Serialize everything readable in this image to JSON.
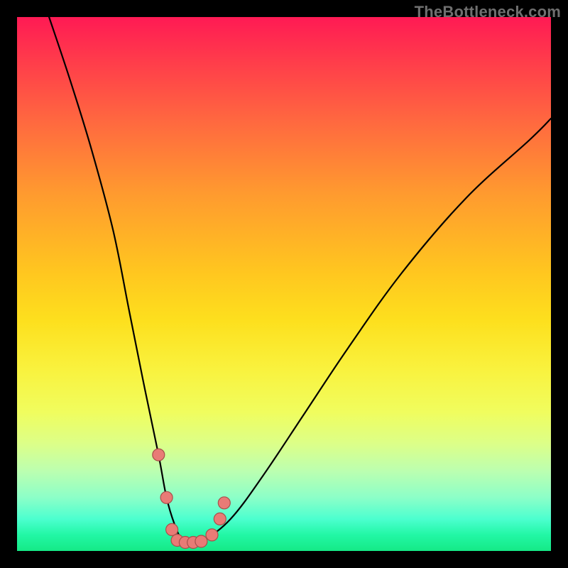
{
  "watermark": "TheBottleneck.com",
  "chart_data": {
    "type": "line",
    "title": "",
    "xlabel": "",
    "ylabel": "",
    "xlim": [
      0,
      100
    ],
    "ylim": [
      0,
      100
    ],
    "grid": false,
    "legend": false,
    "background": "vertical-gradient-red-to-green",
    "series": [
      {
        "name": "bottleneck-curve",
        "x": [
          6,
          10,
          14,
          18,
          21,
          24,
          26.5,
          28,
          29.5,
          31,
          33,
          35,
          40,
          46,
          54,
          62,
          72,
          84,
          96,
          100
        ],
        "values": [
          100,
          88,
          75,
          60,
          45,
          30,
          18,
          10,
          5,
          2,
          1.5,
          2,
          6,
          14,
          26,
          38,
          52,
          66,
          77,
          81
        ]
      }
    ],
    "markers": [
      {
        "x": 26.5,
        "y": 18
      },
      {
        "x": 28.0,
        "y": 10
      },
      {
        "x": 29.0,
        "y": 4
      },
      {
        "x": 30.0,
        "y": 2
      },
      {
        "x": 31.5,
        "y": 1.6
      },
      {
        "x": 33.0,
        "y": 1.6
      },
      {
        "x": 34.5,
        "y": 1.8
      },
      {
        "x": 36.5,
        "y": 3
      },
      {
        "x": 38.0,
        "y": 6
      },
      {
        "x": 38.8,
        "y": 9
      }
    ],
    "note": "Values are estimated in a 0–100 normalized coordinate space; no axis ticks or numeric labels are rendered in the image."
  }
}
